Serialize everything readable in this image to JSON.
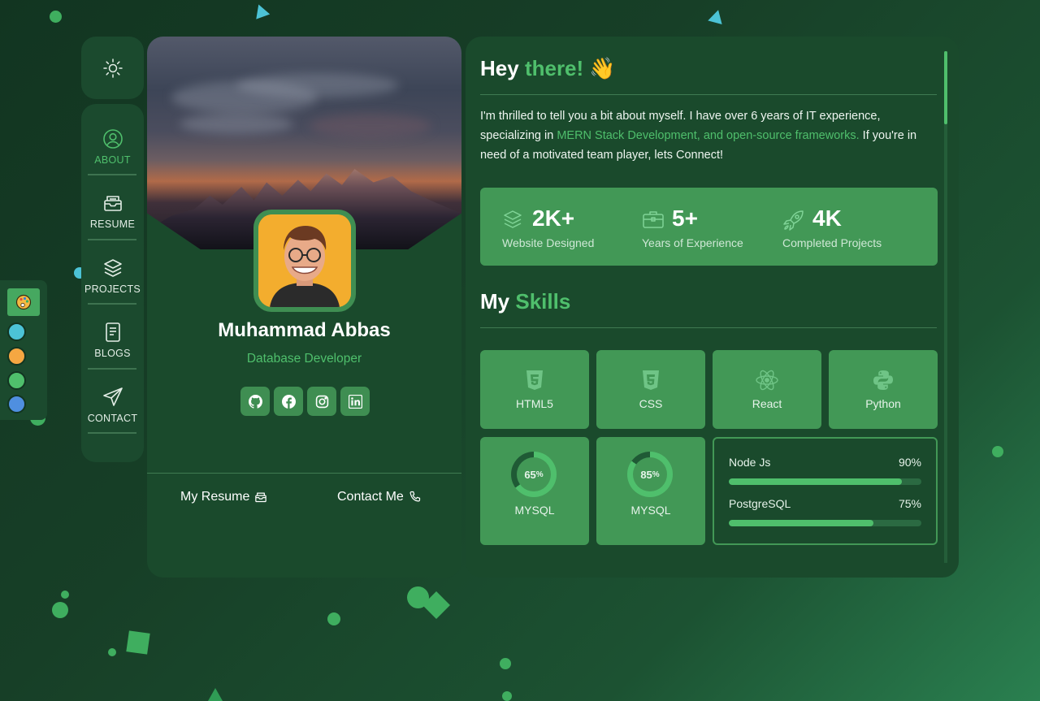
{
  "nav": {
    "theme_toggle_icon": "sun-icon",
    "items": [
      {
        "label": "ABOUT",
        "icon": "user-circle-icon",
        "active": true
      },
      {
        "label": "RESUME",
        "icon": "inbox-icon",
        "active": false
      },
      {
        "label": "PROJECTS",
        "icon": "layers-icon",
        "active": false
      },
      {
        "label": "BLOGS",
        "icon": "document-icon",
        "active": false
      },
      {
        "label": "CONTACT",
        "icon": "send-icon",
        "active": false
      }
    ]
  },
  "theme_picker": {
    "icon": "palette-icon",
    "colors": [
      "#4cc3d6",
      "#f5a742",
      "#4fbf6c",
      "#4f8fe0"
    ]
  },
  "profile": {
    "name": "Muhammad Abbas",
    "role": "Database Developer",
    "socials": [
      "github-icon",
      "facebook-icon",
      "instagram-icon",
      "linkedin-icon"
    ],
    "resume_label": "My Resume",
    "contact_label": "Contact Me"
  },
  "about": {
    "greeting_part1": "Hey",
    "greeting_part2": "there!",
    "greeting_emoji": "👋",
    "intro_part1": "I'm thrilled to tell you a bit about myself. I have over 6 years of IT experience, specializing in",
    "intro_highlight": "MERN Stack Development, and open-source frameworks.",
    "intro_part2": "If you're in need of a motivated team player, lets Connect!",
    "stats": [
      {
        "value": "2K+",
        "label": "Website Designed",
        "icon": "layers-icon"
      },
      {
        "value": "5+",
        "label": "Years of Experience",
        "icon": "briefcase-icon"
      },
      {
        "value": "4K",
        "label": "Completed Projects",
        "icon": "rocket-icon"
      }
    ],
    "skills_title_part1": "My",
    "skills_title_part2": "Skills",
    "skills": [
      {
        "label": "HTML5",
        "icon": "html5-icon"
      },
      {
        "label": "CSS",
        "icon": "css3-icon"
      },
      {
        "label": "React",
        "icon": "react-icon"
      },
      {
        "label": "Python",
        "icon": "python-icon"
      }
    ],
    "rings": [
      {
        "value_text": "65",
        "unit": "%",
        "percent": 65,
        "label": "MYSQL"
      },
      {
        "value_text": "85",
        "unit": "%",
        "percent": 85,
        "label": "MYSQL"
      }
    ],
    "bars": [
      {
        "label": "Node Js",
        "value_text": "90%",
        "percent": 90
      },
      {
        "label": "PostgreSQL",
        "value_text": "75%",
        "percent": 75
      }
    ]
  },
  "colors": {
    "accent": "#4fbf6c",
    "card": "#1a4a2c",
    "tile": "#429856"
  }
}
